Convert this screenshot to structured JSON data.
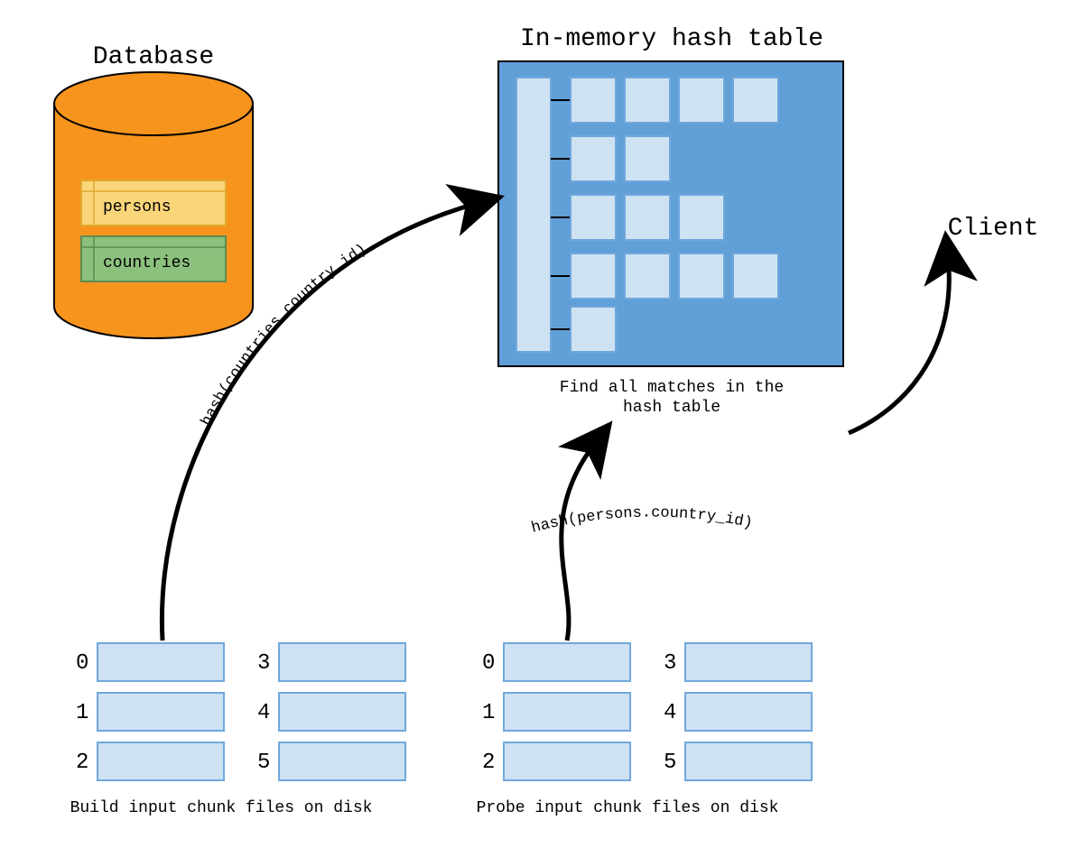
{
  "titles": {
    "database": "Database",
    "hashTable": "In-memory hash table",
    "client": "Client",
    "findMatches1": "Find all matches in the",
    "findMatches2": "hash table",
    "buildCaption": "Build input chunk files on disk",
    "probeCaption": "Probe input chunk files on disk"
  },
  "tables": {
    "persons": "persons",
    "countries": "countries"
  },
  "arrows": {
    "buildHash": "hash(countries.country_id)",
    "probeHash": "hash(persons.country_id)"
  },
  "chunks": {
    "left": [
      "0",
      "1",
      "2",
      "3",
      "4",
      "5"
    ],
    "right": [
      "0",
      "1",
      "2",
      "3",
      "4",
      "5"
    ]
  },
  "colors": {
    "orange": "#f7941d",
    "orangeStroke": "#000000",
    "yellowFill": "#fbd579",
    "yellowStroke": "#e0a92e",
    "greenFill": "#8cc07d",
    "greenStroke": "#5d8c4f",
    "bluePanel": "#619fd7",
    "bluePanelStroke": "#000000",
    "lightBlue": "#cfe2f3",
    "lightBlueStroke": "#6fa8dc",
    "chunkStroke": "#6fa8dc"
  }
}
